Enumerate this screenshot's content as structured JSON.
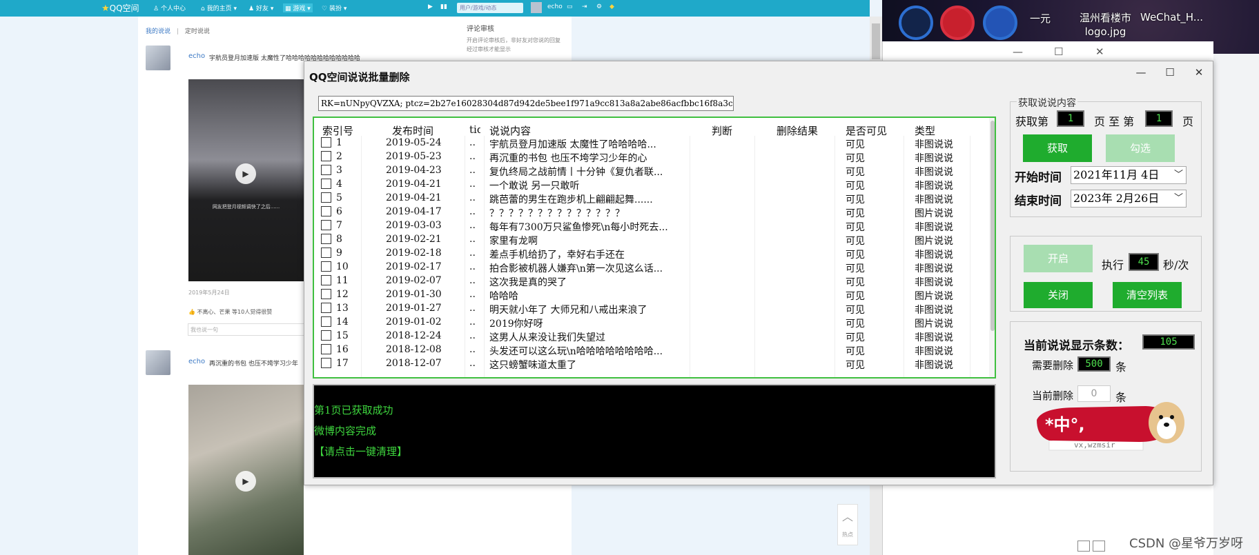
{
  "browser": {
    "nav": {
      "logo": "QQ空间",
      "personal_center": "个人中心",
      "my_home": "我的主页",
      "friends": "好友",
      "games": "游戏",
      "dressup": "装扮",
      "search_placeholder": "用户/游戏/动态",
      "username": "echo"
    },
    "tabs": {
      "my_posts": "我的说说",
      "scheduled": "定时说说",
      "separator": "|"
    },
    "review": {
      "title": "评论审核",
      "desc": "开启评论审核后，非好友对您说的回复经过审核才能显示"
    },
    "posts": [
      {
        "name": "echo",
        "text": "宇航员登月加速版 太魔性了哈哈哈哈哈哈哈哈哈哈哈哈",
        "video_caption": "网友把登月视频调快了之后......",
        "date": "2019年5月24日",
        "likes": "不离心、芒果 等10人觉得很赞",
        "comment_placeholder": "我也说一句"
      },
      {
        "name": "echo",
        "text": "再沉重的书包 也压不垮学习少年"
      }
    ],
    "float_label": "热点"
  },
  "desktop": {
    "icons": [
      {
        "label": ""
      },
      {
        "label": ""
      },
      {
        "label": ""
      }
    ],
    "labels": [
      "一元",
      "温州看楼市\nlogo.jpg",
      "WeChat_H..."
    ],
    "watermark": "CSDN @星爷万岁呀"
  },
  "app": {
    "title": "QQ空间说说批量删除",
    "controls": {
      "minimize": "—",
      "maximize": "☐",
      "close": "✕"
    },
    "cookie": "RK=nUNpyQVZXA; ptcz=2b27e16028304d87d942de5bee1f971a9cc813a8a2abe86acfbbc16f8a3c",
    "table": {
      "headers": [
        "索引号",
        "发布时间",
        "tid",
        "说说内容",
        "判断",
        "删除结果",
        "是否可见",
        "类型"
      ],
      "rows": [
        {
          "idx": "1",
          "date": "2019-05-24",
          "tid": "..",
          "content": "宇航员登月加速版 太魔性了哈哈哈哈...",
          "visible": "可见",
          "type": "非图说说"
        },
        {
          "idx": "2",
          "date": "2019-05-23",
          "tid": "..",
          "content": "再沉重的书包 也压不垮学习少年的心",
          "visible": "可见",
          "type": "非图说说"
        },
        {
          "idx": "3",
          "date": "2019-04-23",
          "tid": "..",
          "content": "复仇终局之战前情丨十分钟《复仇者联...",
          "visible": "可见",
          "type": "非图说说"
        },
        {
          "idx": "4",
          "date": "2019-04-21",
          "tid": "..",
          "content": "一个敢说 另一只敢听",
          "visible": "可见",
          "type": "非图说说"
        },
        {
          "idx": "5",
          "date": "2019-04-21",
          "tid": "..",
          "content": "跳芭蕾的男生在跑步机上翩翩起舞......",
          "visible": "可见",
          "type": "非图说说"
        },
        {
          "idx": "6",
          "date": "2019-04-17",
          "tid": "..",
          "content": "？？？？？？？？？？？？？？",
          "visible": "可见",
          "type": "图片说说"
        },
        {
          "idx": "7",
          "date": "2019-03-03",
          "tid": "..",
          "content": "每年有7300万只鲨鱼惨死\\n每小时死去...",
          "visible": "可见",
          "type": "非图说说"
        },
        {
          "idx": "8",
          "date": "2019-02-21",
          "tid": "..",
          "content": "家里有龙啊",
          "visible": "可见",
          "type": "图片说说"
        },
        {
          "idx": "9",
          "date": "2019-02-18",
          "tid": "..",
          "content": "差点手机给扔了，幸好右手还在",
          "visible": "可见",
          "type": "非图说说"
        },
        {
          "idx": "10",
          "date": "2019-02-17",
          "tid": "..",
          "content": "拍合影被机器人嫌弃\\n第一次见这么话...",
          "visible": "可见",
          "type": "非图说说"
        },
        {
          "idx": "11",
          "date": "2019-02-07",
          "tid": "..",
          "content": "这次我是真的哭了",
          "visible": "可见",
          "type": "非图说说"
        },
        {
          "idx": "12",
          "date": "2019-01-30",
          "tid": "..",
          "content": "哈哈哈",
          "visible": "可见",
          "type": "图片说说"
        },
        {
          "idx": "13",
          "date": "2019-01-27",
          "tid": "..",
          "content": "明天就小年了 大师兄和八戒出来浪了",
          "visible": "可见",
          "type": "非图说说"
        },
        {
          "idx": "14",
          "date": "2019-01-02",
          "tid": "..",
          "content": "2019你好呀",
          "visible": "可见",
          "type": "图片说说"
        },
        {
          "idx": "15",
          "date": "2018-12-24",
          "tid": "..",
          "content": "这男人从来没让我们失望过",
          "visible": "可见",
          "type": "非图说说"
        },
        {
          "idx": "16",
          "date": "2018-12-08",
          "tid": "..",
          "content": "头发还可以这么玩\\n哈哈哈哈哈哈哈哈...",
          "visible": "可见",
          "type": "非图说说"
        },
        {
          "idx": "17",
          "date": "2018-12-07",
          "tid": "..",
          "content": "这只螃蟹味道太重了",
          "visible": "可见",
          "type": "非图说说"
        }
      ]
    },
    "log": [
      "第1页已获取成功",
      "微博内容完成",
      "【请点击一键清理】"
    ],
    "fetch": {
      "group_title": "获取说说内容",
      "get_page_prefix": "获取第",
      "page_from": "1",
      "page_mid": "页 至 第",
      "page_to": "1",
      "page_suffix": "页",
      "fetch_btn": "获取",
      "check_btn": "勾选",
      "start_label": "开始时间",
      "start_date": "2021年11月  4日",
      "end_label": "结束时间",
      "end_date": "2023年  2月26日"
    },
    "run": {
      "start_btn": "开启",
      "exec_label": "执行",
      "interval": "45",
      "interval_unit": "秒/次",
      "close_btn": "关闭",
      "clear_btn": "清空列表"
    },
    "stats": {
      "count_label": "当前说说显示条数：",
      "count": "105",
      "need_label": "需要删除",
      "need": "500",
      "need_unit": "条",
      "current_label": "当前删除",
      "current": "0",
      "current_unit": "条",
      "banner_text": "*中°,",
      "banner_sub": "vx,wzmsir"
    }
  }
}
